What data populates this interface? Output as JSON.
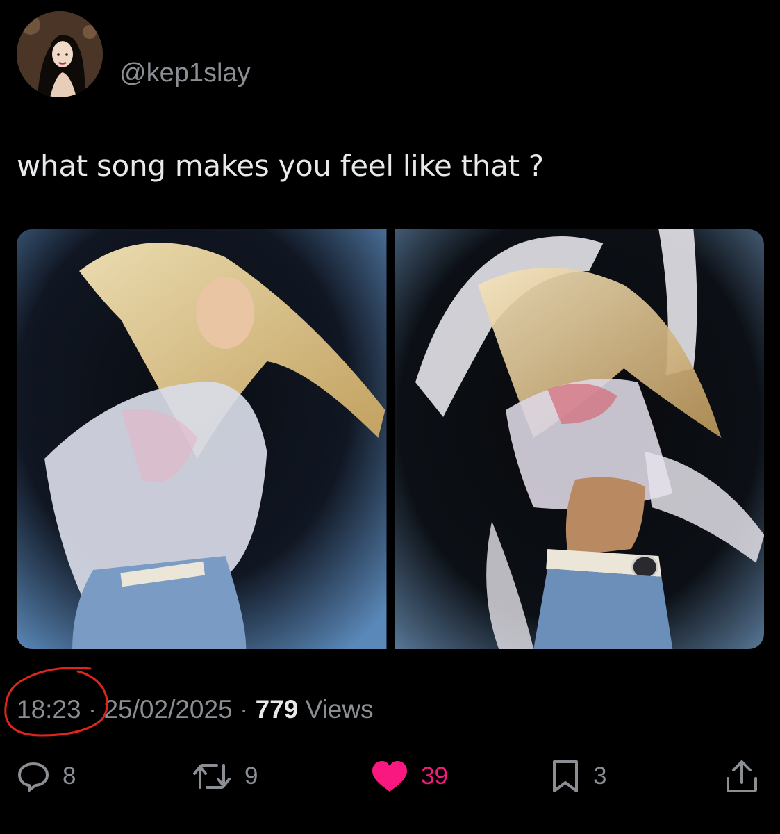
{
  "author": {
    "handle": "@kep1slay",
    "avatar": "profile-photo"
  },
  "tweet": {
    "text": "what song makes you feel like that ?",
    "media": [
      {
        "name": "photo-left",
        "description": "dancer-photo"
      },
      {
        "name": "photo-right",
        "description": "dancer-photo"
      }
    ]
  },
  "meta": {
    "time": "18:23",
    "separator": "·",
    "date": "25/02/2025",
    "views_count": "779",
    "views_label": "Views"
  },
  "actions": {
    "replies": {
      "icon": "reply-icon",
      "count": "8"
    },
    "reposts": {
      "icon": "repost-icon",
      "count": "9"
    },
    "likes": {
      "icon": "heart-icon",
      "count": "39",
      "liked": true
    },
    "bookmarks": {
      "icon": "bookmark-icon",
      "count": "3"
    },
    "share": {
      "icon": "share-icon"
    }
  },
  "colors": {
    "background": "#000000",
    "text": "#e7e9ea",
    "muted": "#8b8f94",
    "like": "#f91880",
    "annotation": "#e0261c"
  }
}
